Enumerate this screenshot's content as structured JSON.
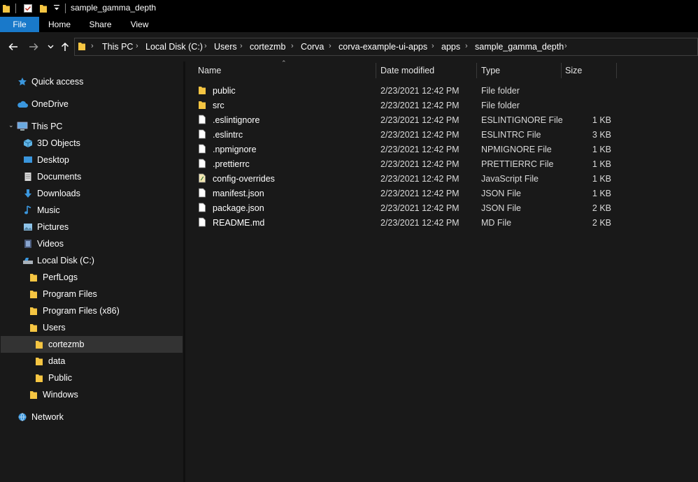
{
  "window": {
    "title": "sample_gamma_depth"
  },
  "ribbon": {
    "tabs": [
      "File",
      "Home",
      "Share",
      "View"
    ]
  },
  "address": {
    "breadcrumbs": [
      "This PC",
      "Local Disk (C:)",
      "Users",
      "cortezmb",
      "Corva",
      "corva-example-ui-apps",
      "apps",
      "sample_gamma_depth"
    ]
  },
  "nav": {
    "quick_access": "Quick access",
    "onedrive": "OneDrive",
    "this_pc": "This PC",
    "objects3d": "3D Objects",
    "desktop": "Desktop",
    "documents": "Documents",
    "downloads": "Downloads",
    "music": "Music",
    "pictures": "Pictures",
    "videos": "Videos",
    "local_disk": "Local Disk (C:)",
    "perflogs": "PerfLogs",
    "program_files": "Program Files",
    "program_files_x86": "Program Files (x86)",
    "users": "Users",
    "cortezmb": "cortezmb",
    "data": "data",
    "public": "Public",
    "windows": "Windows",
    "network": "Network"
  },
  "columns": {
    "name": "Name",
    "date": "Date modified",
    "type": "Type",
    "size": "Size"
  },
  "files": [
    {
      "name": "public",
      "date": "2/23/2021 12:42 PM",
      "type": "File folder",
      "size": "",
      "icon": "folder-icon"
    },
    {
      "name": "src",
      "date": "2/23/2021 12:42 PM",
      "type": "File folder",
      "size": "",
      "icon": "folder-icon"
    },
    {
      "name": ".eslintignore",
      "date": "2/23/2021 12:42 PM",
      "type": "ESLINTIGNORE File",
      "size": "1 KB",
      "icon": "file-icon"
    },
    {
      "name": ".eslintrc",
      "date": "2/23/2021 12:42 PM",
      "type": "ESLINTRC File",
      "size": "3 KB",
      "icon": "file-icon"
    },
    {
      "name": ".npmignore",
      "date": "2/23/2021 12:42 PM",
      "type": "NPMIGNORE File",
      "size": "1 KB",
      "icon": "file-icon"
    },
    {
      "name": ".prettierrc",
      "date": "2/23/2021 12:42 PM",
      "type": "PRETTIERRC File",
      "size": "1 KB",
      "icon": "file-icon"
    },
    {
      "name": "config-overrides",
      "date": "2/23/2021 12:42 PM",
      "type": "JavaScript File",
      "size": "1 KB",
      "icon": "script-file-icon"
    },
    {
      "name": "manifest.json",
      "date": "2/23/2021 12:42 PM",
      "type": "JSON File",
      "size": "1 KB",
      "icon": "file-icon"
    },
    {
      "name": "package.json",
      "date": "2/23/2021 12:42 PM",
      "type": "JSON File",
      "size": "2 KB",
      "icon": "file-icon"
    },
    {
      "name": "README.md",
      "date": "2/23/2021 12:42 PM",
      "type": "MD File",
      "size": "2 KB",
      "icon": "file-icon"
    }
  ],
  "colors": {
    "accent": "#1979ca",
    "folder": "#f5c542",
    "background": "#191919",
    "selection": "#333333"
  }
}
